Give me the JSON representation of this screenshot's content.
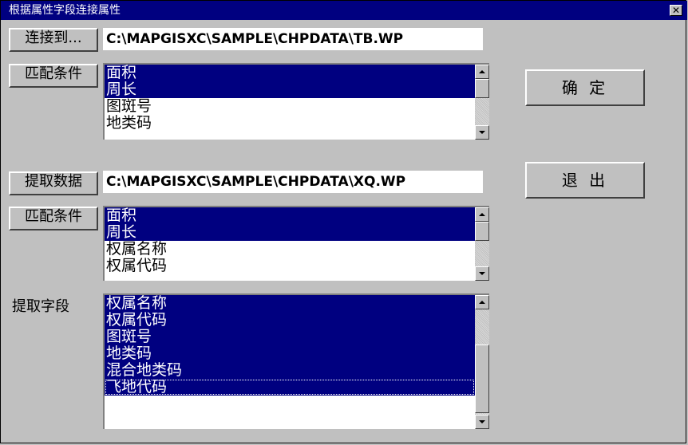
{
  "window": {
    "title": "根据属性字段连接属性",
    "close_glyph": "✕"
  },
  "connect": {
    "button_label": "连接到...",
    "path": "C:\\MAPGISXC\\SAMPLE\\CHPDATA\\TB.WP"
  },
  "match1": {
    "button_label": "匹配条件",
    "items": [
      "面积",
      "周长",
      "图斑号",
      "地类码"
    ],
    "selected": [
      0,
      1
    ]
  },
  "extract": {
    "button_label": "提取数据",
    "path": "C:\\MAPGISXC\\SAMPLE\\CHPDATA\\XQ.WP"
  },
  "match2": {
    "button_label": "匹配条件",
    "items": [
      "面积",
      "周长",
      "权属名称",
      "权属代码"
    ],
    "selected": [
      0,
      1
    ]
  },
  "fields": {
    "label": "提取字段",
    "items": [
      "权属名称",
      "权属代码",
      "图斑号",
      "地类码",
      "混合地类码",
      "飞地代码"
    ],
    "selected": [
      0,
      1,
      2,
      3,
      4,
      5
    ],
    "focused": 5
  },
  "actions": {
    "ok_label": "确 定",
    "exit_label": "退 出"
  },
  "colors": {
    "title_bar": "#000080",
    "selection": "#000080",
    "face": "#c0c0c0"
  }
}
